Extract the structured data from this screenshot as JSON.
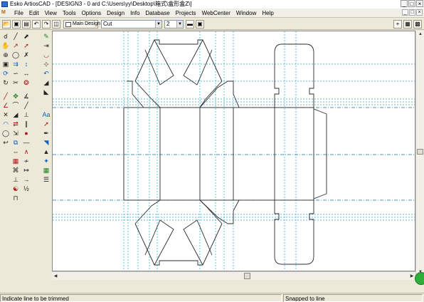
{
  "window": {
    "title": "Esko ArtiosCAD - [DESIGN3 - 0 ard C:\\Users\\yy\\Desktop\\箱式\\盒形盒Z\\]",
    "controls": {
      "minimize": "_",
      "maximize": "□",
      "close": "×"
    }
  },
  "menubar": {
    "items": [
      "File",
      "Edit",
      "View",
      "Tools",
      "Options",
      "Design",
      "Info",
      "Database",
      "Projects",
      "WebCenter",
      "Window",
      "Help"
    ],
    "mdi_controls": {
      "minimize": "_",
      "restore": "□",
      "close": "×"
    }
  },
  "toolbar": {
    "main_design_label": "Main Design",
    "linetype_value": "Cut",
    "pointage_value": "2",
    "icons": [
      "open-icon",
      "save-icon",
      "print-icon",
      "undo-icon",
      "redo-icon",
      "layers-icon"
    ],
    "right_icons": [
      "magnify-plus-icon",
      "zoom-extents-icon",
      "layout-icon"
    ]
  },
  "statusbar": {
    "message": "Indicate line to be trimmed",
    "snap": "Snapped to  line"
  },
  "colors": {
    "cut_line": "#2b2b2b",
    "crease_line": "#1a6f9a",
    "guide_line": "#2aa8c8",
    "window_bg": "#ece9d8"
  }
}
